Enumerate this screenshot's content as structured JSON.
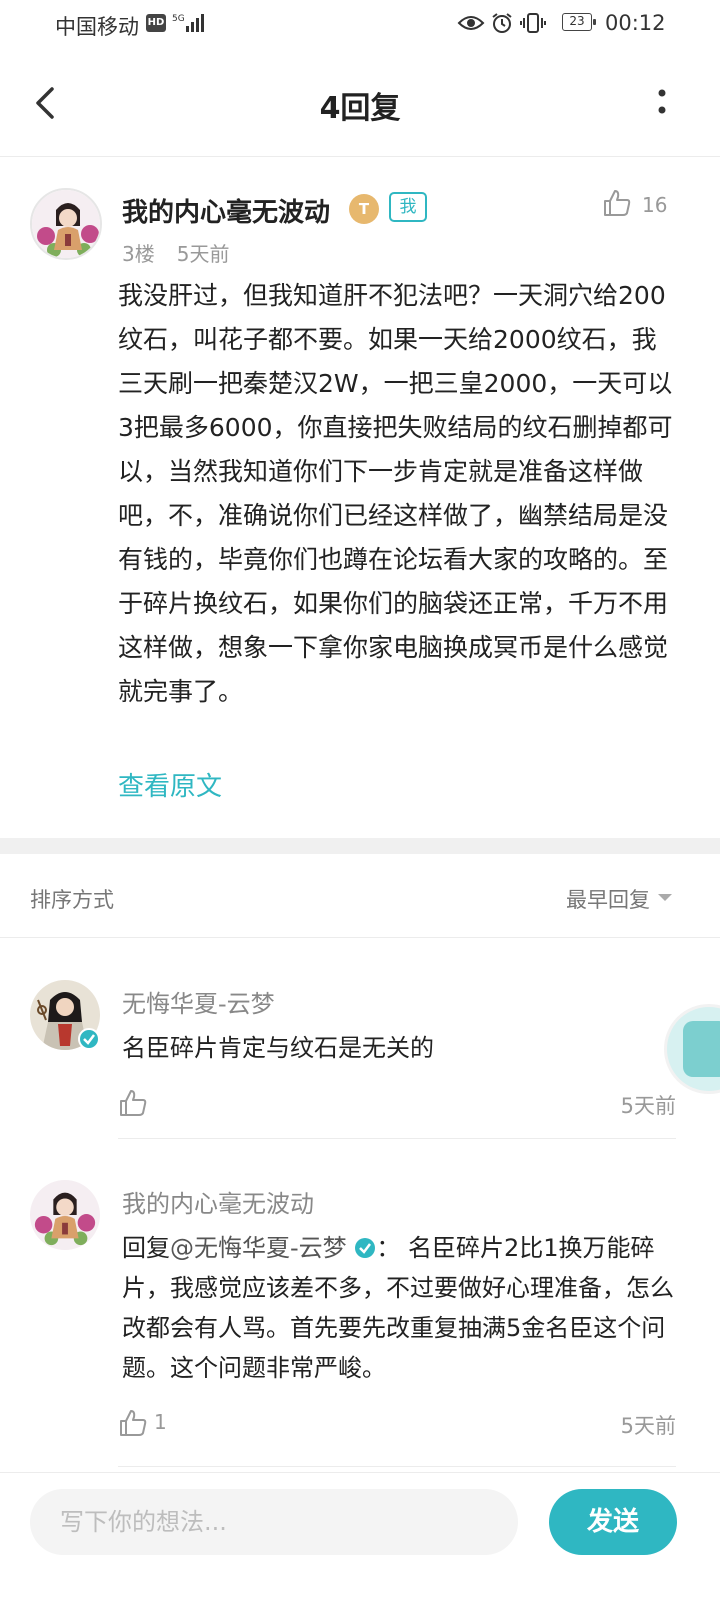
{
  "status_bar": {
    "carrier": "中国移动",
    "hd": "HD",
    "network": "5G",
    "battery": "23",
    "time": "00:12"
  },
  "header": {
    "title": "4回复",
    "back_icon": "chevron-left-icon",
    "more_icon": "more-vertical-icon"
  },
  "post": {
    "author": "我的内心毫无波动",
    "level_badge": "T",
    "me_tag": "我",
    "likes": "16",
    "floor": "3楼",
    "time": "5天前",
    "body": "我没肝过，但我知道肝不犯法吧？一天洞穴给200纹石，叫花子都不要。如果一天给2000纹石，我三天刷一把秦楚汉2W，一把三皇2000，一天可以3把最多6000，你直接把失败结局的纹石删掉都可以，当然我知道你们下一步肯定就是准备这样做吧，不，准确说你们已经这样做了，幽禁结局是没有钱的，毕竟你们也蹲在论坛看大家的攻略的。至于碎片换纹石，如果你们的脑袋还正常，千万不用这样做，想象一下拿你家电脑换成冥币是什么感觉就完事了。",
    "view_original": "查看原文"
  },
  "sort": {
    "label": "排序方式",
    "value": "最早回复"
  },
  "replies": [
    {
      "author": "无悔华夏-云梦",
      "text": "名臣碎片肯定与纹石是无关的",
      "likes": "",
      "time": "5天前"
    },
    {
      "author": "我的内心毫无波动",
      "reply_prefix": "回复",
      "mention": "@无悔华夏-云梦",
      "text": "：  名臣碎片2比1换万能碎片，我感觉应该差不多，不过要做好心理准备，怎么改都会有人骂。首先要先改重复抽满5金名臣这个问题。这个问题非常严峻。",
      "likes": "1",
      "time": "5天前"
    }
  ],
  "bottom_bar": {
    "input_placeholder": "写下你的想法...",
    "send_label": "发送"
  },
  "colors": {
    "accent": "#2fb7c2",
    "level_badge": "#e7b86e",
    "float_button": "#7ccfcf"
  }
}
